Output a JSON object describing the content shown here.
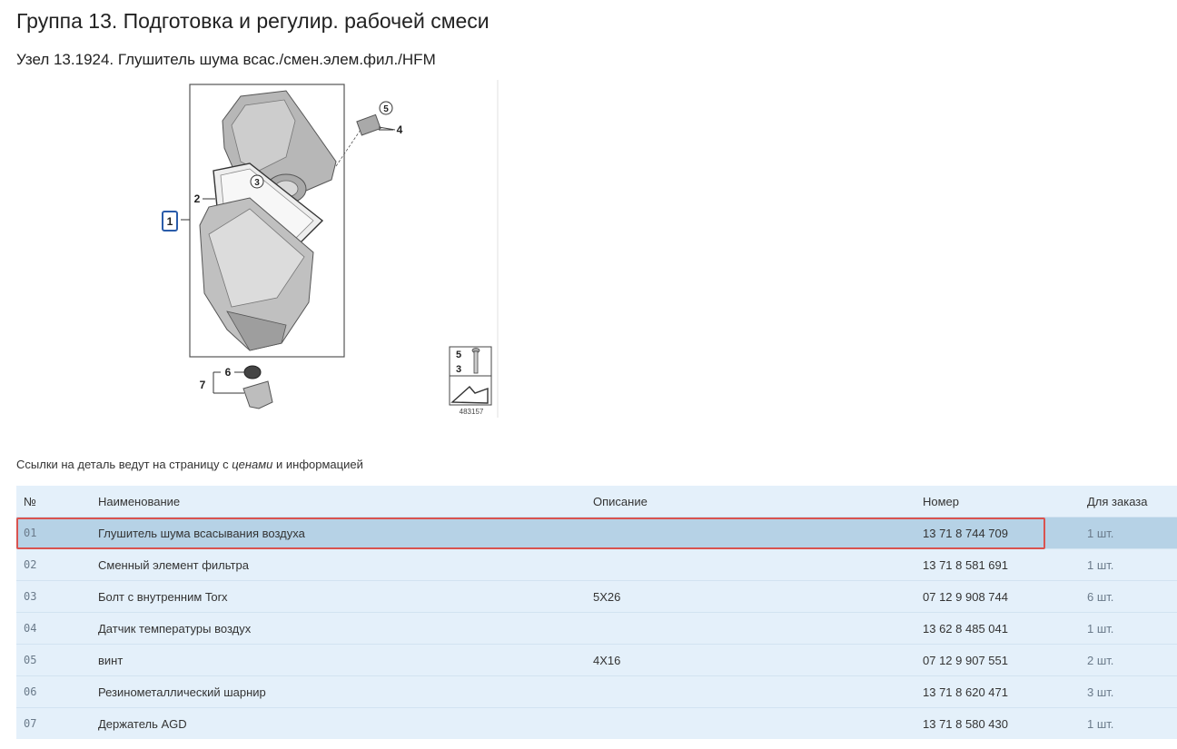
{
  "header": {
    "group_title": "Группа 13. Подготовка и регулир. рабочей смеси",
    "node_title": "Узел 13.1924. Глушитель шума всас./смен.элем.фил./HFM"
  },
  "diagram": {
    "callouts": [
      "1",
      "2",
      "3",
      "4",
      "5",
      "6",
      "7"
    ],
    "legend_numbers": [
      "5",
      "3"
    ],
    "image_id": "483157"
  },
  "caption": {
    "before": "Ссылки на деталь ведут на страницу с ",
    "emph": "ценами",
    "after": " и информацией"
  },
  "table": {
    "headers": [
      "№",
      "Наименование",
      "Описание",
      "Номер",
      "Для заказа"
    ],
    "rows": [
      {
        "num": "01",
        "name": "Глушитель шума всасывания воздуха",
        "desc": "",
        "part": "13 71 8 744 709",
        "qty": "1 шт."
      },
      {
        "num": "02",
        "name": "Сменный элемент фильтра",
        "desc": "",
        "part": "13 71 8 581 691",
        "qty": "1 шт."
      },
      {
        "num": "03",
        "name": "Болт с внутренним Torx",
        "desc": "5X26",
        "part": "07 12 9 908 744",
        "qty": "6 шт."
      },
      {
        "num": "04",
        "name": "Датчик температуры воздух",
        "desc": "",
        "part": "13 62 8 485 041",
        "qty": "1 шт."
      },
      {
        "num": "05",
        "name": "винт",
        "desc": "4X16",
        "part": "07 12 9 907 551",
        "qty": "2 шт."
      },
      {
        "num": "06",
        "name": "Резинометаллический шарнир",
        "desc": "",
        "part": "13 71 8 620 471",
        "qty": "3 шт."
      },
      {
        "num": "07",
        "name": "Держатель AGD",
        "desc": "",
        "part": "13 71 8 580 430",
        "qty": "1 шт."
      }
    ]
  },
  "colors": {
    "row_bg": "#e4f0fa",
    "selected_row_bg": "#b6d2e6",
    "highlight_border": "#d9534f",
    "callout_box": "#2a5caa"
  }
}
